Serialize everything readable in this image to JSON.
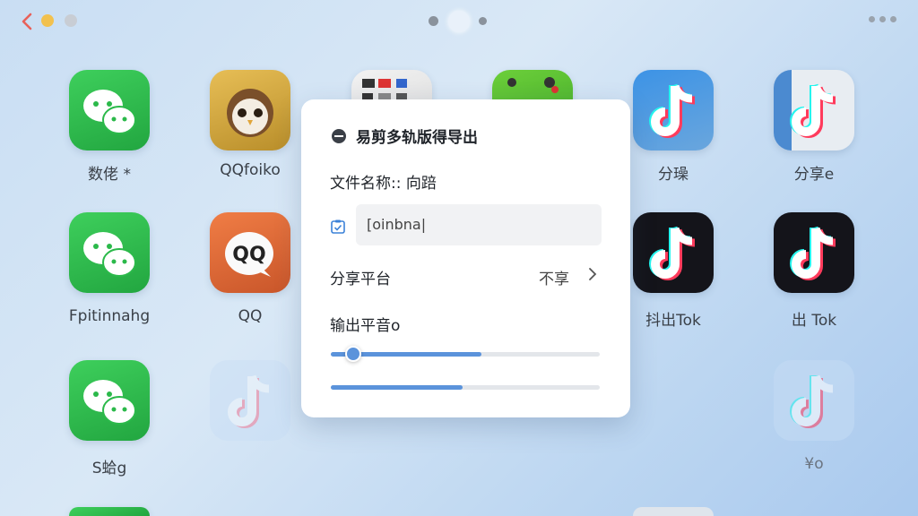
{
  "top_bar": {
    "back_icon": "chevron-left-icon",
    "more_icon": "more-dots-icon"
  },
  "apps": [
    {
      "icon": "wechat-icon",
      "label": "数佬 *"
    },
    {
      "icon": "owl-icon",
      "label": "QQfoiko"
    },
    {
      "icon": "photo-grid-icon",
      "label": ""
    },
    {
      "icon": "green-sticker-icon",
      "label": ""
    },
    {
      "icon": "tiktok-icon",
      "label": "分璪"
    },
    {
      "icon": "tiktok-icon",
      "label": "分享e"
    },
    {
      "icon": "wechat-icon",
      "label": "Fpitinnahg"
    },
    {
      "icon": "qq-icon",
      "label": "QQ"
    },
    {
      "icon": "tiktok-icon",
      "label": "抖出Tok"
    },
    {
      "icon": "tiktok-icon",
      "label": "出 Tok"
    },
    {
      "icon": "wechat-icon",
      "label": "S蛤g"
    },
    {
      "icon": "tiktok-icon",
      "label": ""
    },
    {
      "icon": "tiktok-icon",
      "label": "¥o"
    }
  ],
  "dialog": {
    "title": "易剪多轨版得导出",
    "filename_label": "文件名称:: 向踣",
    "filename_value": "[oinbna|",
    "share_label": "分享平台",
    "share_value": "不享",
    "volume_label": "输出平音o",
    "slider1_level": 0.56,
    "slider2_level": 0.49
  },
  "colors": {
    "accent": "#5b93db",
    "wechat_green": "#2bb94a",
    "back_red": "#e8615a"
  }
}
